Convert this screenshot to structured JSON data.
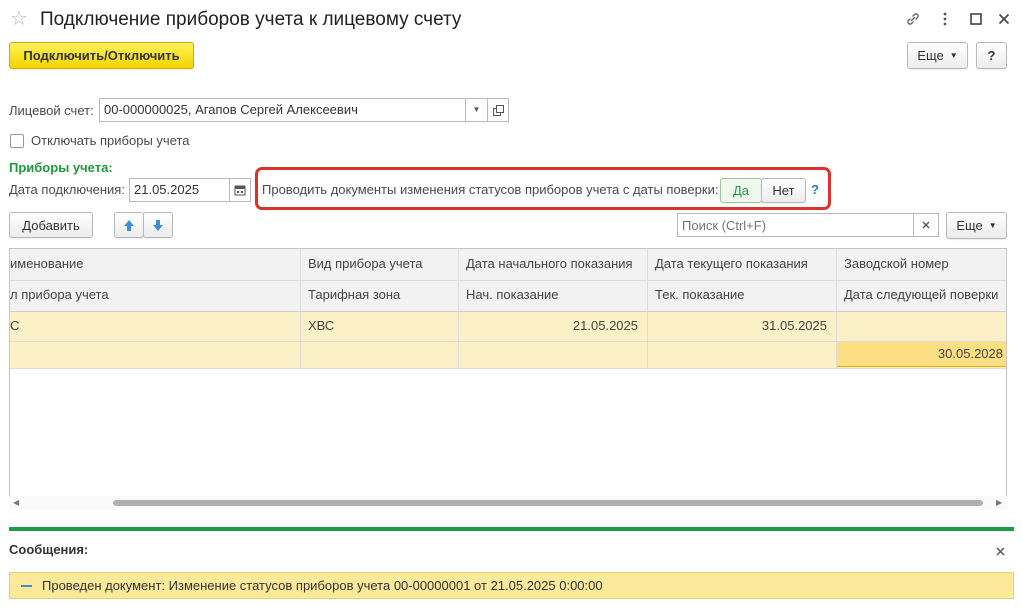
{
  "window": {
    "title": "Подключение приборов учета к лицевому счету"
  },
  "toolbar": {
    "connect_label": "Подключить/Отключить",
    "more_label": "Еще",
    "help_label": "?"
  },
  "form": {
    "account_label": "Лицевой счет:",
    "account_value": "00-000000025, Агапов Сергей Алексеевич",
    "disable_label": "Отключать приборы учета",
    "meters_heading": "Приборы учета:",
    "date_label": "Дата подключения:",
    "date_value": "21.05.2025",
    "status_docs_label": "Проводить документы изменения статусов приборов учета с даты поверки:",
    "yes_label": "Да",
    "no_label": "Нет",
    "question_label": "?"
  },
  "table_toolbar": {
    "add_label": "Добавить",
    "search_placeholder": "Поиск (Ctrl+F)",
    "more_label": "Еще"
  },
  "table": {
    "headers_row1": [
      "именование",
      "Вид прибора учета",
      "Дата начального показания",
      "Дата текущего показания",
      "Заводской номер"
    ],
    "headers_row2": [
      "л прибора учета",
      "Тарифная зона",
      "Нач. показание",
      "Тек. показание",
      "Дата следующей поверки"
    ],
    "rows": [
      {
        "line1": [
          "С",
          "ХВС",
          "21.05.2025",
          "31.05.2025",
          ""
        ],
        "line2": [
          "",
          "",
          "",
          "",
          "30.05.2028"
        ]
      }
    ]
  },
  "messages": {
    "title": "Сообщения:",
    "text": "Проведен документ: Изменение статусов приборов учета 00-00000001 от 21.05.2025 0:00:00"
  },
  "colors": {
    "accent_green": "#1f9a4a",
    "highlight_red": "#d9342b",
    "button_yellow": "#f2d500",
    "row_yellow": "#fbf0c6"
  }
}
